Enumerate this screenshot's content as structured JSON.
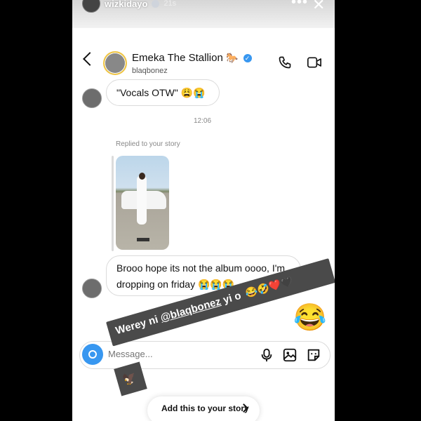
{
  "story": {
    "username": "wizkidayo",
    "time": "21s",
    "more_icon": "more-dots-icon",
    "close_icon": "close-icon"
  },
  "dm_header": {
    "name": "Emeka The Stallion",
    "name_emoji": "🐎",
    "username": "blaqbonez"
  },
  "messages": {
    "first": "\"Vocals OTW\" 😩😭",
    "timestamp": "12:06",
    "replied_label": "Replied to your story",
    "second_line1": "Brooo hope its not the album oooo, I'm",
    "second_line2": "dropping on friday 😭😭😭",
    "reaction_emoji": "😂"
  },
  "composer": {
    "placeholder": "Message..."
  },
  "overlay": {
    "prefix": "Werey ni ",
    "mention": "@blaqbonez",
    "suffix": " yi o ",
    "emojis": "😂🤣❤️🖤",
    "tail_icon": "🦅"
  },
  "add_story": {
    "label": "Add this to your story"
  },
  "colors": {
    "accent_blue": "#3897f0",
    "overlay_bg": "#4a4a4a",
    "story_ring": "#f0c542"
  }
}
